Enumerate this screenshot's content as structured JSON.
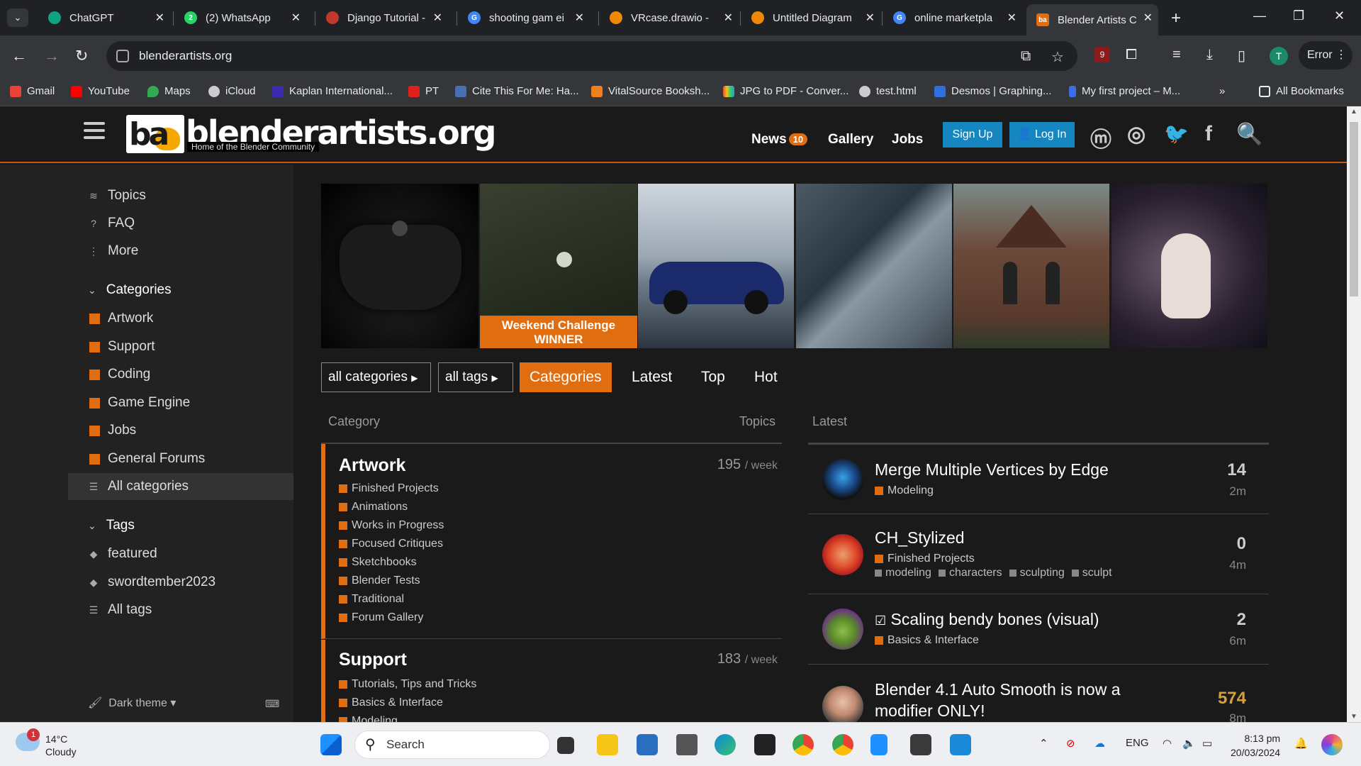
{
  "browser": {
    "tabs": [
      {
        "title": "ChatGPT",
        "favicon_color": "#10a37f"
      },
      {
        "title": "(2) WhatsApp",
        "favicon_color": "#25d366"
      },
      {
        "title": "Django Tutorial -",
        "favicon_color": "#c0392b"
      },
      {
        "title": "shooting gam ei",
        "favicon_color": "#4285f4"
      },
      {
        "title": "VRcase.drawio -",
        "favicon_color": "#f08705"
      },
      {
        "title": "Untitled Diagram",
        "favicon_color": "#f08705"
      },
      {
        "title": "online marketpla",
        "favicon_color": "#4285f4"
      },
      {
        "title": "Blender Artists C",
        "favicon_color": "#e06e10",
        "active": true
      }
    ],
    "url": "blenderartists.org",
    "extension_badge": "9",
    "profile_initial": "T",
    "error_label": "Error",
    "bookmarks": [
      {
        "label": "Gmail",
        "color": "#ea4335"
      },
      {
        "label": "YouTube",
        "color": "#ff0000"
      },
      {
        "label": "Maps",
        "color": "#34a853"
      },
      {
        "label": "iCloud",
        "color": "#cccccc"
      },
      {
        "label": "Kaplan International...",
        "color": "#3b2bb0"
      },
      {
        "label": "PT",
        "color": "#e0201b"
      },
      {
        "label": "Cite This For Me: Ha...",
        "color": "#4a6fb5"
      },
      {
        "label": "VitalSource Booksh...",
        "color": "#f07f1d"
      },
      {
        "label": "JPG to PDF - Conver...",
        "color": "#8e44ad"
      },
      {
        "label": "test.html",
        "color": "#cccccc"
      },
      {
        "label": "Desmos | Graphing...",
        "color": "#2f6fde"
      },
      {
        "label": "My first project – M...",
        "color": "#3b6ee8"
      }
    ],
    "all_bookmarks": "All Bookmarks"
  },
  "site": {
    "logo_mark": "ba",
    "logo_text": "blenderartists.org",
    "logo_tagline": "Home of the Blender Community",
    "nav": {
      "news": "News",
      "news_count": "10",
      "gallery": "Gallery",
      "jobs": "Jobs"
    },
    "signup": "Sign Up",
    "login": "Log In"
  },
  "sidebar": {
    "top": [
      {
        "label": "Topics",
        "icon": "layers-icon"
      },
      {
        "label": "FAQ",
        "icon": "question-icon"
      },
      {
        "label": "More",
        "icon": "more-vertical-icon"
      }
    ],
    "categories_heading": "Categories",
    "categories": [
      "Artwork",
      "Support",
      "Coding",
      "Game Engine",
      "Jobs",
      "General Forums"
    ],
    "all_categories": "All categories",
    "tags_heading": "Tags",
    "tags": [
      "featured",
      "swordtember2023"
    ],
    "all_tags": "All tags",
    "theme": "Dark theme"
  },
  "banner": {
    "challenge_label": "Weekend Challenge WINNER"
  },
  "filters": {
    "all_categories": "all categories",
    "all_tags": "all tags",
    "tabs": [
      "Categories",
      "Latest",
      "Top",
      "Hot"
    ]
  },
  "categories_table": {
    "col_category": "Category",
    "col_topics": "Topics",
    "rows": [
      {
        "name": "Artwork",
        "count": "195",
        "per": "/ week",
        "subs": [
          "Finished Projects",
          "Animations",
          "Works in Progress",
          "Focused Critiques",
          "Sketchbooks",
          "Blender Tests",
          "Traditional",
          "Forum Gallery"
        ]
      },
      {
        "name": "Support",
        "count": "183",
        "per": "/ week",
        "subs": [
          "Tutorials, Tips and Tricks",
          "Basics & Interface",
          "Modeling"
        ]
      }
    ]
  },
  "latest": {
    "heading": "Latest",
    "topics": [
      {
        "title": "Merge Multiple Vertices by Edge",
        "category": "Modeling",
        "tags": [],
        "count": "14",
        "age": "2m"
      },
      {
        "title": "CH_Stylized",
        "category": "Finished Projects",
        "tags": [
          "modeling",
          "characters",
          "sculpting",
          "sculpt"
        ],
        "count": "0",
        "age": "4m"
      },
      {
        "title": "Scaling bendy bones (visual)",
        "category": "Basics & Interface",
        "tags": [],
        "count": "2",
        "age": "6m",
        "solved": true
      },
      {
        "title": "Blender 4.1 Auto Smooth is now a modifier ONLY!",
        "category": "",
        "tags": [],
        "count": "574",
        "age": "8m",
        "hot": true
      }
    ]
  },
  "taskbar": {
    "weather_temp": "14°C",
    "weather_desc": "Cloudy",
    "weather_badge": "1",
    "search": "Search",
    "lang": "ENG",
    "time": "8:13 pm",
    "date": "20/03/2024"
  }
}
